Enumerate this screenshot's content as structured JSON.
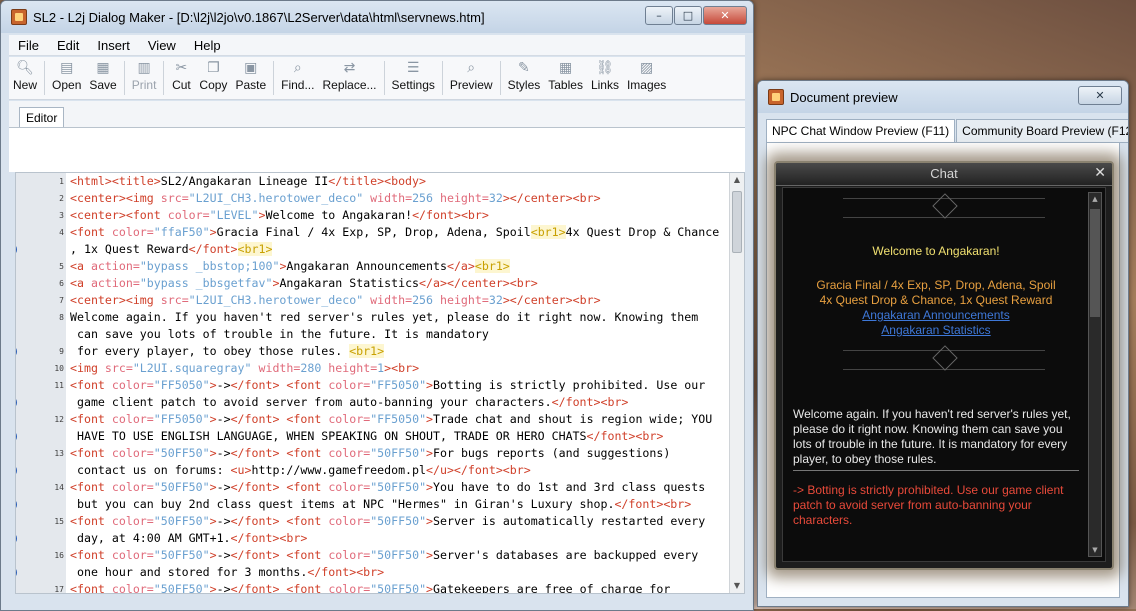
{
  "main_window": {
    "title": "SL2 - L2j Dialog Maker - [D:\\l2j\\l2jo\\v0.1867\\L2Server\\data\\html\\servnews.htm]",
    "caption_min": "–",
    "caption_max": "□",
    "caption_close": "✕"
  },
  "menu": [
    "File",
    "Edit",
    "Insert",
    "View",
    "Help"
  ],
  "toolbar": [
    {
      "label": "New",
      "icon": "magnifier-icon",
      "glyph": "🔍︎",
      "enabled": true
    },
    {
      "label": "Open",
      "icon": "open-icon",
      "glyph": "▤",
      "enabled": true
    },
    {
      "label": "Save",
      "icon": "save-icon",
      "glyph": "▦",
      "enabled": true
    },
    {
      "label": "Print",
      "icon": "print-icon",
      "glyph": "▥",
      "enabled": false
    },
    {
      "label": "Cut",
      "icon": "cut-icon",
      "glyph": "✂",
      "enabled": true
    },
    {
      "label": "Copy",
      "icon": "copy-icon",
      "glyph": "❐",
      "enabled": true
    },
    {
      "label": "Paste",
      "icon": "paste-icon",
      "glyph": "▣",
      "enabled": true
    },
    {
      "label": "Find...",
      "icon": "find-icon",
      "glyph": "⌕",
      "enabled": true
    },
    {
      "label": "Replace...",
      "icon": "replace-icon",
      "glyph": "⇄",
      "enabled": true
    },
    {
      "label": "Settings",
      "icon": "settings-icon",
      "glyph": "☰",
      "enabled": true
    },
    {
      "label": "Preview",
      "icon": "preview-icon",
      "glyph": "⌕",
      "enabled": true
    },
    {
      "label": "Styles",
      "icon": "styles-icon",
      "glyph": "✎",
      "enabled": true
    },
    {
      "label": "Tables",
      "icon": "tables-icon",
      "glyph": "▦",
      "enabled": true
    },
    {
      "label": "Links",
      "icon": "links-icon",
      "glyph": "⛓",
      "enabled": true
    },
    {
      "label": "Images",
      "icon": "images-icon",
      "glyph": "▨",
      "enabled": true
    }
  ],
  "editor_tab": "Editor",
  "code_lines": [
    {
      "n": "1",
      "wrap": false,
      "html": "<span class=\"t\">&lt;html&gt;&lt;title&gt;</span>SL2/Angakaran Lineage II<span class=\"t\">&lt;/title&gt;&lt;body&gt;</span>"
    },
    {
      "n": "2",
      "wrap": false,
      "html": "<span class=\"t\">&lt;center&gt;&lt;img </span><span class=\"a\">src=</span><span class=\"v\">\"L2UI_CH3.herotower_deco\"</span><span class=\"a\"> width=</span><span class=\"v\">256</span><span class=\"a\"> height=</span><span class=\"v\">32</span><span class=\"t\">&gt;&lt;/center&gt;&lt;br&gt;</span>"
    },
    {
      "n": "3",
      "wrap": false,
      "html": "<span class=\"t\">&lt;center&gt;&lt;font </span><span class=\"a\">color=</span><span class=\"v\">\"LEVEL\"</span><span class=\"t\">&gt;</span>Welcome to Angakaran!<span class=\"t\">&lt;/font&gt;&lt;br&gt;</span>"
    },
    {
      "n": "4",
      "wrap": false,
      "html": "<span class=\"t\">&lt;font </span><span class=\"a\">color=</span><span class=\"v\">\"ffaF50\"</span><span class=\"t\">&gt;</span>Gracia Final / 4x Exp, SP, Drop, Adena, Spoil<span class=\"y\">&lt;br1&gt;</span>4x Quest Drop &amp; Chance"
    },
    {
      "n": "",
      "wrap": true,
      "html": ", 1x Quest Reward<span class=\"t\">&lt;/font&gt;</span><span class=\"y\">&lt;br1&gt;</span>"
    },
    {
      "n": "5",
      "wrap": false,
      "html": "<span class=\"t\">&lt;a </span><span class=\"a\">action=</span><span class=\"v\">\"bypass _bbstop;100\"</span><span class=\"t\">&gt;</span>Angakaran Announcements<span class=\"t\">&lt;/a&gt;</span><span class=\"y\">&lt;br1&gt;</span>"
    },
    {
      "n": "6",
      "wrap": false,
      "html": "<span class=\"t\">&lt;a </span><span class=\"a\">action=</span><span class=\"v\">\"bypass _bbsgetfav\"</span><span class=\"t\">&gt;</span>Angakaran Statistics<span class=\"t\">&lt;/a&gt;&lt;/center&gt;&lt;br&gt;</span>"
    },
    {
      "n": "7",
      "wrap": false,
      "html": "<span class=\"t\">&lt;center&gt;&lt;img </span><span class=\"a\">src=</span><span class=\"v\">\"L2UI_CH3.herotower_deco\"</span><span class=\"a\"> width=</span><span class=\"v\">256</span><span class=\"a\"> height=</span><span class=\"v\">32</span><span class=\"t\">&gt;&lt;/center&gt;&lt;br&gt;</span>"
    },
    {
      "n": "8",
      "wrap": false,
      "html": "Welcome again. If you haven't red server's rules yet, please do it right now. Knowing them"
    },
    {
      "n": "",
      "wrap": false,
      "html": " can save you lots of trouble in the future. It is mandatory"
    },
    {
      "n": "9",
      "wrap": true,
      "html": " for every player, to obey those rules. <span class=\"y\">&lt;br1&gt;</span>"
    },
    {
      "n": "10",
      "wrap": false,
      "html": "<span class=\"t\">&lt;img </span><span class=\"a\">src=</span><span class=\"v\">\"L2UI.squaregray\"</span><span class=\"a\"> width=</span><span class=\"v\">280</span><span class=\"a\"> height=</span><span class=\"v\">1</span><span class=\"t\">&gt;&lt;br&gt;</span>"
    },
    {
      "n": "11",
      "wrap": false,
      "html": "<span class=\"t\">&lt;font </span><span class=\"a\">color=</span><span class=\"v\">\"FF5050\"</span><span class=\"t\">&gt;</span>-&gt;<span class=\"t\">&lt;/font&gt; &lt;font </span><span class=\"a\">color=</span><span class=\"v\">\"FF5050\"</span><span class=\"t\">&gt;</span>Botting is strictly prohibited. Use our"
    },
    {
      "n": "",
      "wrap": true,
      "html": " game client patch to avoid server from auto-banning your characters.<span class=\"t\">&lt;/font&gt;&lt;br&gt;</span>"
    },
    {
      "n": "12",
      "wrap": false,
      "html": "<span class=\"t\">&lt;font </span><span class=\"a\">color=</span><span class=\"v\">\"FF5050\"</span><span class=\"t\">&gt;</span>-&gt;<span class=\"t\">&lt;/font&gt; &lt;font </span><span class=\"a\">color=</span><span class=\"v\">\"FF5050\"</span><span class=\"t\">&gt;</span>Trade chat and shout is region wide; YOU"
    },
    {
      "n": "",
      "wrap": true,
      "html": " HAVE TO USE ENGLISH LANGUAGE, WHEN SPEAKING ON SHOUT, TRADE OR HERO CHATS<span class=\"t\">&lt;/font&gt;&lt;br&gt;</span>"
    },
    {
      "n": "13",
      "wrap": false,
      "html": "<span class=\"t\">&lt;font </span><span class=\"a\">color=</span><span class=\"v\">\"50FF50\"</span><span class=\"t\">&gt;</span>-&gt;<span class=\"t\">&lt;/font&gt; &lt;font </span><span class=\"a\">color=</span><span class=\"v\">\"50FF50\"</span><span class=\"t\">&gt;</span>For bugs reports (and suggestions)"
    },
    {
      "n": "",
      "wrap": true,
      "html": " contact us on forums: <span class=\"t\">&lt;u&gt;</span>http://www.gamefreedom.pl<span class=\"t\">&lt;/u&gt;&lt;/font&gt;&lt;br&gt;</span>"
    },
    {
      "n": "14",
      "wrap": false,
      "html": "<span class=\"t\">&lt;font </span><span class=\"a\">color=</span><span class=\"v\">\"50FF50\"</span><span class=\"t\">&gt;</span>-&gt;<span class=\"t\">&lt;/font&gt; &lt;font </span><span class=\"a\">color=</span><span class=\"v\">\"50FF50\"</span><span class=\"t\">&gt;</span>You have to do 1st and 3rd class quests"
    },
    {
      "n": "",
      "wrap": true,
      "html": " but you can buy 2nd class quest items at NPC \"Hermes\" in Giran's Luxury shop.<span class=\"t\">&lt;/font&gt;&lt;br&gt;</span>"
    },
    {
      "n": "15",
      "wrap": false,
      "html": "<span class=\"t\">&lt;font </span><span class=\"a\">color=</span><span class=\"v\">\"50FF50\"</span><span class=\"t\">&gt;</span>-&gt;<span class=\"t\">&lt;/font&gt; &lt;font </span><span class=\"a\">color=</span><span class=\"v\">\"50FF50\"</span><span class=\"t\">&gt;</span>Server is automatically restarted every"
    },
    {
      "n": "",
      "wrap": true,
      "html": " day, at 4:00 AM GMT+1.<span class=\"t\">&lt;/font&gt;&lt;br&gt;</span>"
    },
    {
      "n": "16",
      "wrap": false,
      "html": "<span class=\"t\">&lt;font </span><span class=\"a\">color=</span><span class=\"v\">\"50FF50\"</span><span class=\"t\">&gt;</span>-&gt;<span class=\"t\">&lt;/font&gt; &lt;font </span><span class=\"a\">color=</span><span class=\"v\">\"50FF50\"</span><span class=\"t\">&gt;</span>Server's databases are backupped every"
    },
    {
      "n": "",
      "wrap": true,
      "html": " one hour and stored for 3 months.<span class=\"t\">&lt;/font&gt;&lt;br&gt;</span>"
    },
    {
      "n": "17",
      "wrap": false,
      "html": "<span class=\"t\">&lt;font </span><span class=\"a\">color=</span><span class=\"v\">\"50FF50\"</span><span class=\"t\">&gt;</span>-&gt;<span class=\"t\">&lt;/font&gt; &lt;font </span><span class=\"a\">color=</span><span class=\"v\">\"50FF50\"</span><span class=\"t\">&gt;</span>Gatekeepers are free of charge for"
    }
  ],
  "preview_window": {
    "title": "Document preview",
    "caption_close": "✕",
    "tabs": [
      "NPC Chat Window Preview (F11)",
      "Community Board Preview (F12)"
    ],
    "chat_title": "Chat",
    "chat_close": "✕",
    "welcome": "Welcome to Angakaran!",
    "line1": "Gracia Final / 4x Exp, SP, Drop, Adena, Spoil",
    "line2": "4x Quest Drop & Chance, 1x Quest Reward",
    "link1": "Angakaran Announcements",
    "link2": "Angakaran Statistics",
    "rules": "Welcome again. If you haven't red server's rules yet, please do it right now. Knowing them can save you lots of trouble in the future. It is mandatory for every player, to obey those rules.",
    "botting": "-> Botting is strictly prohibited. Use our game client patch to avoid server from auto-banning your characters."
  }
}
